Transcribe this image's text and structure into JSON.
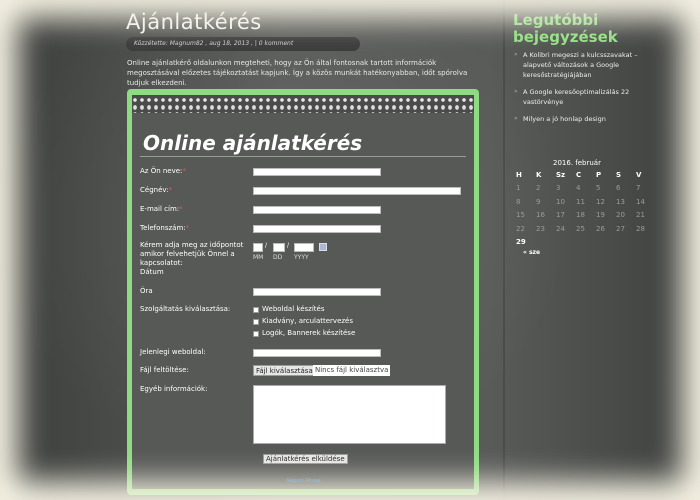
{
  "page": {
    "title": "Ajánlatkérés",
    "meta": "Közzétette: Magnum82 , aug 18, 2013 , | 0 komment",
    "intro": "Online ajánlatkérő oldalunkon megteheti, hogy az Ön által fontosnak tartott információk megosztásával előzetes tájékoztatást kapjunk. Így a közös munkát hatékonyabban, időt spórolva tudjuk elkezdeni."
  },
  "form": {
    "title": "Online ajánlatkérés",
    "name_label": "Az Ön neve:",
    "company_label": "Cégnév:",
    "email_label": "E-mail cím:",
    "phone_label": "Telefonszám:",
    "required_mark": "*",
    "date_label_1": "Kérem adja meg az időpontot",
    "date_label_2": "amikor felvehetjük Önnel a",
    "date_label_3": "kapcsolatot:",
    "date_label_4": "Dátum",
    "date_sep": "/",
    "mm": "MM",
    "dd": "DD",
    "yyyy": "YYYY",
    "time_label": "Óra",
    "service_label": "Szolgáltatás kiválasztása:",
    "services": [
      "Weboldal készítés",
      "Kiadvány, arculattervezés",
      "Logók, Bannerek készítése"
    ],
    "website_label": "Jelenlegi weboldal:",
    "file_label": "Fájl feltöltése:",
    "file_button": "Fájl kiválasztása",
    "file_status": "Nincs fájl kiválasztva",
    "other_label": "Egyéb információk:",
    "submit": "Ajánlatkérés elküldése",
    "report_link": "Report Abuse"
  },
  "sidebar": {
    "title_1": "Legutóbbi",
    "title_2": "bejegyzések",
    "posts": [
      "A Kolibri megeszi a kulcsszavakat – alapvető változások a Google keresőstratégiájában",
      "A Google keresőoptimalizálás 22 vastörvénye",
      "Milyen a jó honlap design"
    ],
    "bullet": "»"
  },
  "calendar": {
    "caption": "2016. február",
    "days": [
      "H",
      "K",
      "Sz",
      "C",
      "P",
      "S",
      "V"
    ],
    "rows": [
      [
        "1",
        "2",
        "3",
        "4",
        "5",
        "6",
        "7"
      ],
      [
        "8",
        "9",
        "10",
        "11",
        "12",
        "13",
        "14"
      ],
      [
        "15",
        "16",
        "17",
        "18",
        "19",
        "20",
        "21"
      ],
      [
        "22",
        "23",
        "24",
        "25",
        "26",
        "27",
        "28"
      ],
      [
        "29",
        "",
        "",
        "",
        "",
        "",
        ""
      ]
    ],
    "today": "29",
    "prev": "« sze"
  }
}
